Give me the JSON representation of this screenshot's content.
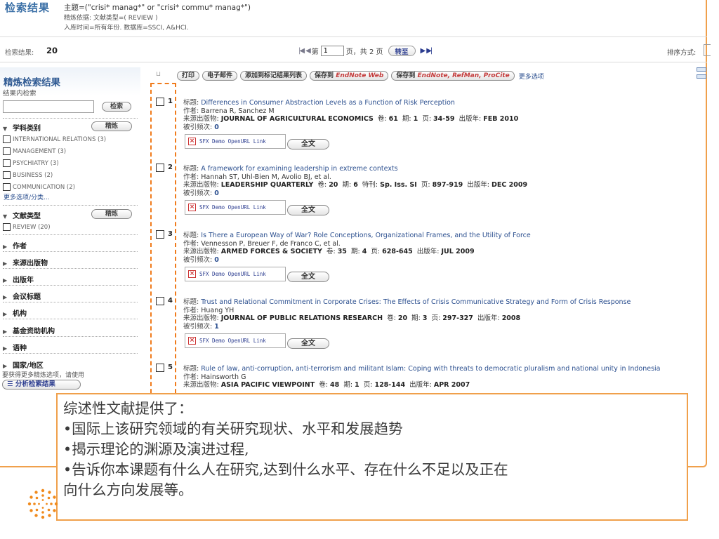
{
  "header": {
    "title": "检索结果",
    "query_line": "主题=(\"crisi* manag*\" or \"crisi* commu* manag*\")",
    "refine_line": "精炼依据: 文献类型=( REVIEW )",
    "scope_line": "入库时间=所有年份. 数据库=SSCI, A&HCI."
  },
  "results_bar": {
    "count_label": "检索结果:",
    "count_value": "20",
    "page_prefix": "第",
    "page_value": "1",
    "page_suffix": "页，共 2 页",
    "goto_label": "转至",
    "sort_label": "排序方式:"
  },
  "sidebar": {
    "title": "精炼检索结果",
    "search_within_label": "结果内检索",
    "search_button": "检索",
    "refine_button": "精炼",
    "subject_header": "学科类别",
    "subject_items": [
      "INTERNATIONAL RELATIONS (3)",
      "MANAGEMENT (3)",
      "PSYCHIATRY (3)",
      "BUSINESS (2)",
      "COMMUNICATION (2)"
    ],
    "more_options": "更多选项/分类...",
    "doctype_header": "文献类型",
    "doctype_items": [
      "REVIEW (20)"
    ],
    "collapsed_sections": [
      "作者",
      "来源出版物",
      "出版年",
      "会议标题",
      "机构",
      "基金资助机构",
      "语种",
      "国家/地区"
    ],
    "note": "要获得更多精炼选项，请使用",
    "analyze_button": "分析检索结果"
  },
  "toolbar": {
    "print": "打印",
    "email": "电子邮件",
    "add_marked": "添加到标记结果列表",
    "save_to": "保存到",
    "endnote_web": "EndNote Web",
    "endnote_refman": "EndNote, RefMan, ProCite",
    "more": "更多选项"
  },
  "record_labels": {
    "title": "标题:",
    "author": "作者:",
    "source": "来源出版物:",
    "volume": "卷:",
    "issue": "期:",
    "special_issue": "特刊:",
    "pages": "页:",
    "published": "出版年:",
    "cited": "被引频次:",
    "sfx": "SFX Demo OpenURL Link",
    "fulltext": "全文"
  },
  "records": [
    {
      "num": "1",
      "title": "Differences in Consumer Abstraction Levels as a Function of Risk Perception",
      "authors": "Barrena R, Sanchez M",
      "source": "JOURNAL OF AGRICULTURAL ECONOMICS",
      "volume": "61",
      "issue": "1",
      "pages": "34-59",
      "published": "FEB 2010",
      "cited": "0"
    },
    {
      "num": "2",
      "title": "A framework for examining leadership in extreme contexts",
      "authors": "Hannah ST, Uhl-Bien M, Avolio BJ, et al.",
      "source": "LEADERSHIP QUARTERLY",
      "volume": "20",
      "issue": "6",
      "special_issue": "Sp. Iss. SI",
      "pages": "897-919",
      "published": "DEC 2009",
      "cited": "0"
    },
    {
      "num": "3",
      "title": "Is There a European Way of War? Role Conceptions, Organizational Frames, and the Utility of Force",
      "authors": "Vennesson P, Breuer F, de Franco C, et al.",
      "source": "ARMED FORCES & SOCIETY",
      "volume": "35",
      "issue": "4",
      "pages": "628-645",
      "published": "JUL 2009",
      "cited": "0"
    },
    {
      "num": "4",
      "title": "Trust and Relational Commitment in Corporate Crises: The Effects of Crisis Communicative Strategy and Form of Crisis Response",
      "authors": "Huang YH",
      "source": "JOURNAL OF PUBLIC RELATIONS RESEARCH",
      "volume": "20",
      "issue": "3",
      "pages": "297-327",
      "published": "2008",
      "cited": "1"
    },
    {
      "num": "5",
      "title": "Rule of law, anti-corruption, anti-terrorism and militant Islam: Coping with threats to democratic pluralism and national unity in Indonesia",
      "authors": "Hainsworth G",
      "source": "ASIA PACIFIC VIEWPOINT",
      "volume": "48",
      "issue": "1",
      "pages": "128-144",
      "published": "APR 2007"
    }
  ],
  "overlay": {
    "lines": [
      "综述性文献提供了：",
      "•国际上该研究领域的有关研究现状、水平和发展趋势",
      "•揭示理论的渊源及演进过程,",
      "•告诉你本课题有什么人在研究,达到什么水平、存在什么不足以及正在",
      "向什么方向发展等。"
    ]
  },
  "colors": {
    "accent_orange": "#f07b1c",
    "frame_orange": "#f0a04b",
    "link_blue": "#2b4f8f",
    "title_blue": "#3a6fa6"
  }
}
